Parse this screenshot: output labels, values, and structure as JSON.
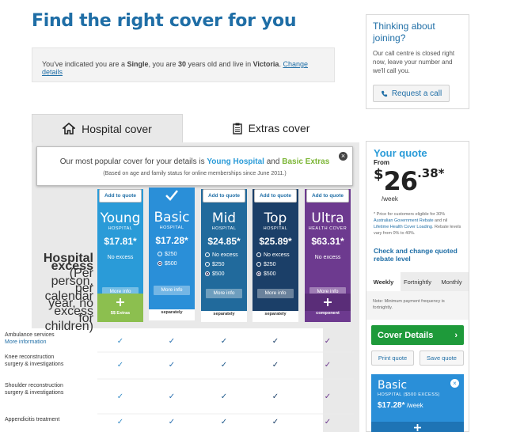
{
  "header": {
    "title": "Find the right cover for you"
  },
  "summary": {
    "p1": "You've indicated you are a ",
    "status": "Single",
    "p2": ", you are ",
    "age": "30",
    "p3": " years old and live in ",
    "state": "Victoria",
    "p4": ". ",
    "change_link": "Change details"
  },
  "join": {
    "title": "Thinking about joining?",
    "text": "Our call centre is closed right now, leave your number and we'll call you.",
    "button": "Request a call"
  },
  "tabs": [
    {
      "label": "Hospital cover",
      "icon": "house-icon"
    },
    {
      "label": "Extras cover",
      "icon": "clipboard-icon"
    }
  ],
  "popular": {
    "p1": "Our most popular cover for your details is ",
    "hosp": "Young Hospital",
    "and": " and ",
    "extras": "Basic Extras",
    "note": "(Based on age and family status for online memberships since June 2011.)"
  },
  "row_labels": {
    "hospital_excess_title": "Hospital excess",
    "hospital_excess_sub": "(Per person, per calendar year, no excess for children)",
    "ambulance": "Ambulance services",
    "more_info": "More information",
    "knee": "Knee reconstruction surgery & investigations",
    "shoulder": "Shoulder reconstruction surgery & investigations",
    "appendicitis": "Appendicitis treatment"
  },
  "plans": [
    {
      "name": "Young",
      "sub": "HOSPITAL",
      "price": "$17.81*",
      "add": "Add to quote",
      "option": "No excess",
      "more": "More info",
      "note": "Price includes Basic $$ Extras",
      "color": "#2a9bd8"
    },
    {
      "name": "Basic",
      "sub": "HOSPITAL",
      "price": "$17.28*",
      "add": "",
      "opts": [
        "$250",
        "$500"
      ],
      "more": "More info",
      "note": "Extras can be added separately",
      "color": "#2a8fd8"
    },
    {
      "name": "Mid",
      "sub": "HOSPITAL",
      "price": "$24.85*",
      "add": "Add to quote",
      "opts": [
        "No excess",
        "$250",
        "$500"
      ],
      "more": "More info",
      "note": "Extras can be added separately",
      "color": "#216a9c"
    },
    {
      "name": "Top",
      "sub": "HOSPITAL",
      "price": "$25.89*",
      "add": "Add to quote",
      "opts": [
        "No excess",
        "$250",
        "$500"
      ],
      "more": "More info",
      "note": "Extras can be added separately",
      "color": "#1b3f68"
    },
    {
      "name": "Ultra",
      "sub": "HEALTH COVER",
      "price": "$63.31*",
      "add": "Add to quote",
      "option": "No excess",
      "more": "More info",
      "note": "Price includes extras component",
      "color": "#6d3a8f"
    }
  ],
  "quote": {
    "title": "Your quote",
    "from": "From",
    "currency": "$",
    "dollars": "26",
    "cents": ".38*",
    "per": "/week",
    "fine1": "* Price for customers eligible for 30% ",
    "fine_link1": "Australian Government Rebate",
    "fine2": " and nil ",
    "fine_link2": "Lifetime Health Cover Loading",
    "fine3": ". Rebate levels vary from 0% to 40%.",
    "check_link": "Check and change quoted rebate level",
    "freq": [
      "Weekly",
      "Fortnightly",
      "Monthly"
    ],
    "freq_note": "Note: Minimum payment frequency is fortnightly.",
    "cover_details": "Cover Details",
    "print": "Print quote",
    "save": "Save quote",
    "mini_name": "Basic",
    "mini_sub": "HOSPITAL ($500 EXCESS)",
    "mini_price": "$17.28*",
    "mini_per": " /week"
  }
}
